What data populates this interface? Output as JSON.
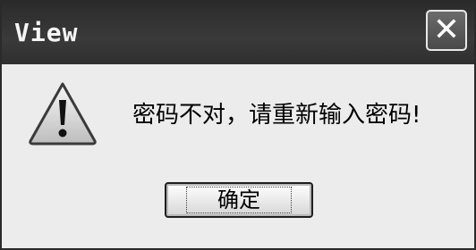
{
  "window": {
    "title": "View",
    "close_symbol": "✕"
  },
  "dialog": {
    "icon": "warning-icon",
    "message": "密码不对，请重新输入密码!",
    "ok_label": "确定"
  }
}
